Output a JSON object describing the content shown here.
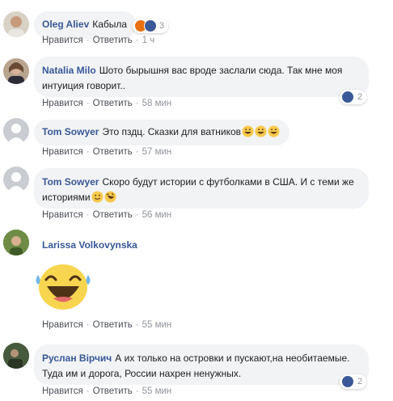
{
  "ui": {
    "like_label": "Нравится",
    "reply_label": "Ответить",
    "separator": "·"
  },
  "comments": [
    {
      "author": "Oleg Aliev",
      "text": "Кабыла",
      "time": "1 ч",
      "reactions": {
        "icons": [
          "angry-icon",
          "like-icon"
        ],
        "count": "3"
      }
    },
    {
      "author": "Natalia Milo",
      "text": "Шото бырышня вас вроде заслали сюда. Так мне моя интуиция говорит..",
      "time": "58 мин",
      "reactions": {
        "icons": [
          "like-icon"
        ],
        "count": "2"
      }
    },
    {
      "author": "Tom Sowyer",
      "text": "Это пздц. Сказки для ватников",
      "emojis": [
        "grinning-sweat-emoji",
        "grinning-sweat-emoji",
        "grinning-sweat-emoji"
      ],
      "time": "57 мин"
    },
    {
      "author": "Tom Sowyer",
      "text": "Скоро будут истории с футболками в США. И с теми же историями",
      "emojis": [
        "smiling-emoji",
        "rolling-laughing-emoji"
      ],
      "time": "56 мин"
    },
    {
      "author": "Larissa Volkovynska",
      "sticker": "laughing-tears-sticker",
      "time": "55 мин"
    },
    {
      "author": "Руслан Вірчич",
      "text": "А их только на островки и пускают,на необитаемые. Туда им и дорога, России нахрен ненужных.",
      "time": "55 мин",
      "reactions": {
        "icons": [
          "like-icon"
        ],
        "count": "2"
      }
    }
  ],
  "colors": {
    "author": "#385898",
    "bubble": "#f2f3f5",
    "meta": "#90949c",
    "like": "#3b5998",
    "angry": "#e9710f"
  }
}
